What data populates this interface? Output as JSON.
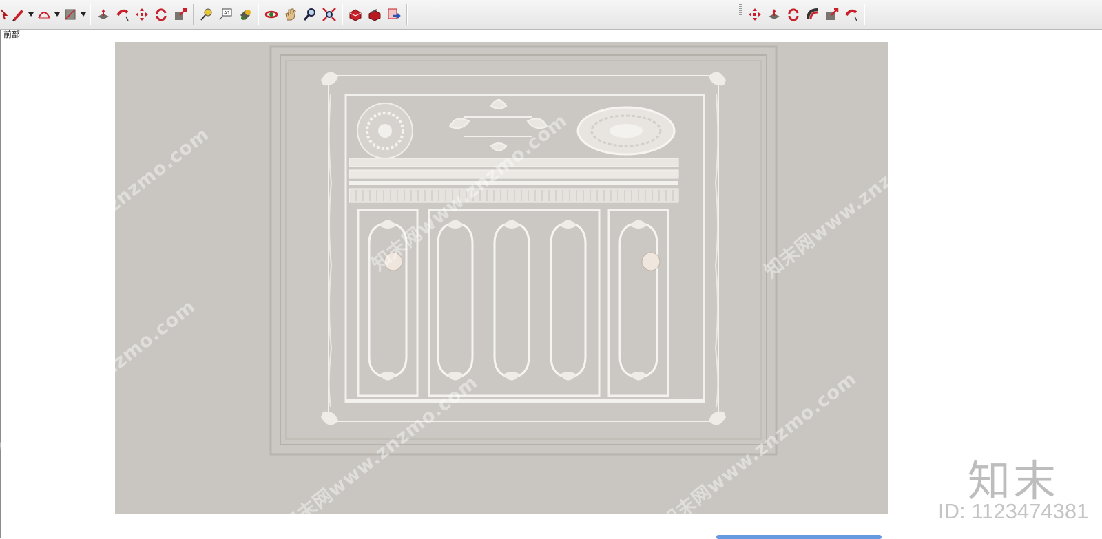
{
  "scene": {
    "label": "前部"
  },
  "toolbar": {
    "left_tools": [
      {
        "name": "select-icon"
      },
      {
        "name": "pencil-icon"
      },
      {
        "name": "arc-icon"
      },
      {
        "name": "rectangle-icon"
      },
      {
        "name": "push-pull-icon"
      },
      {
        "name": "follow-me-icon"
      },
      {
        "name": "move-icon"
      },
      {
        "name": "rotate-icon"
      },
      {
        "name": "scale-icon"
      },
      {
        "name": "tape-measure-icon"
      },
      {
        "name": "text-icon"
      },
      {
        "name": "paint-bucket-icon"
      },
      {
        "name": "orbit-icon"
      },
      {
        "name": "pan-icon"
      },
      {
        "name": "zoom-icon"
      },
      {
        "name": "zoom-extents-icon"
      },
      {
        "name": "warehouse-icon"
      },
      {
        "name": "get-models-icon"
      },
      {
        "name": "share-model-icon"
      }
    ],
    "right_tools": [
      {
        "name": "move-icon"
      },
      {
        "name": "push-pull-icon"
      },
      {
        "name": "rotate-icon"
      },
      {
        "name": "offset-icon"
      },
      {
        "name": "scale-icon"
      },
      {
        "name": "follow-me-icon"
      }
    ]
  },
  "watermark": {
    "text": "知末网www.znzmo.com",
    "brand": "知末",
    "id_label": "ID: 1123474381"
  },
  "colors": {
    "wall": "#c9c6c1",
    "molding": "#f4f2ee",
    "accent_red": "#c8202a"
  }
}
